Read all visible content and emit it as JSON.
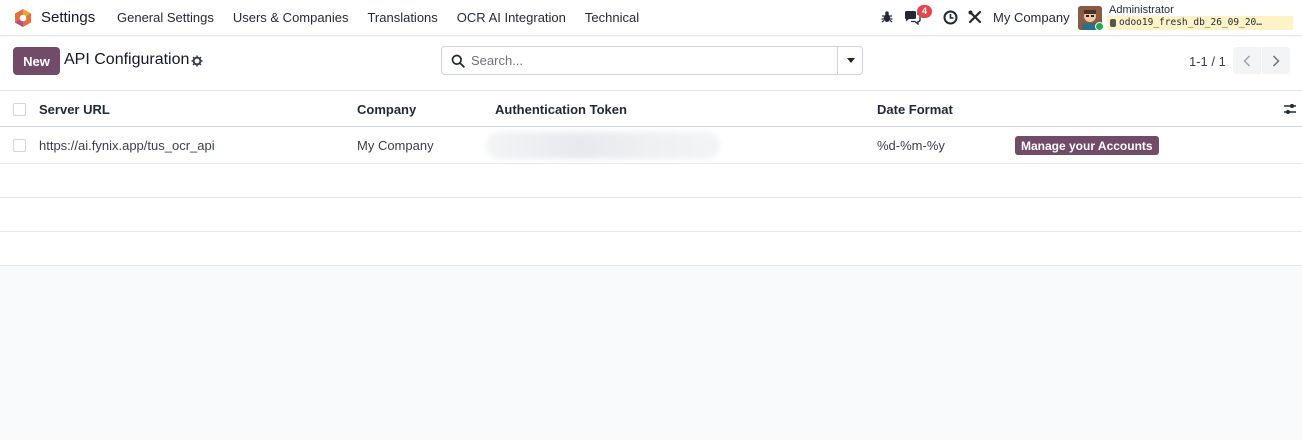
{
  "app": {
    "name": "Settings",
    "logo_icon": "odoo-logo-icon"
  },
  "menu": {
    "items": [
      {
        "label": "General Settings"
      },
      {
        "label": "Users & Companies"
      },
      {
        "label": "Translations"
      },
      {
        "label": "OCR AI Integration"
      },
      {
        "label": "Technical"
      }
    ]
  },
  "systray": {
    "debug_icon": "bug-icon",
    "messages_icon": "chat-icon",
    "messages_count": "4",
    "activity_icon": "clock-icon",
    "tools_icon": "tools-icon",
    "company": "My Company",
    "user": {
      "name": "Administrator",
      "database": "odoo19_fresh_db_26_09_20…"
    }
  },
  "control_panel": {
    "new_label": "New",
    "title": "API Configuration",
    "search": {
      "placeholder": "Search..."
    },
    "pager": {
      "value": "1-1 / 1"
    }
  },
  "list": {
    "columns": [
      "Server URL",
      "Company",
      "Authentication Token",
      "Date Format"
    ],
    "rows": [
      {
        "server_url": "https://ai.fynix.app/tus_ocr_api",
        "company": "My Company",
        "authentication_token": "",
        "date_format": "%d-%m-%y",
        "action_label": "Manage your Accounts"
      }
    ]
  },
  "colors": {
    "primary": "#714b67",
    "badge": "#e0464b",
    "db_highlight": "#fdf3c7"
  }
}
